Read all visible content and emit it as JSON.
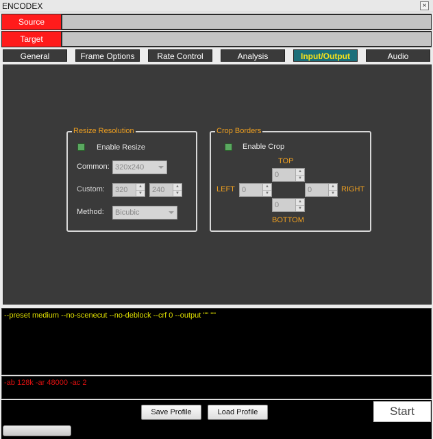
{
  "window": {
    "title": "ENCODEX",
    "close_glyph": "×"
  },
  "source": {
    "label": "Source",
    "path": ""
  },
  "target": {
    "label": "Target",
    "path": ""
  },
  "tabs": [
    {
      "label": "General"
    },
    {
      "label": "Frame Options"
    },
    {
      "label": "Rate Control"
    },
    {
      "label": "Analysis"
    },
    {
      "label": "Input/Output",
      "active": true
    },
    {
      "label": "Audio"
    }
  ],
  "resize": {
    "legend": "Resize Resolution",
    "enable_label": "Enable Resize",
    "common_label": "Common:",
    "common_value": "320x240",
    "custom_label": "Custom:",
    "custom_width": "320",
    "custom_height": "240",
    "method_label": "Method:",
    "method_value": "Bicubic"
  },
  "crop": {
    "legend": "Crop Borders",
    "enable_label": "Enable Crop",
    "top_label": "TOP",
    "bottom_label": "BOTTOM",
    "left_label": "LEFT",
    "right_label": "RIGHT",
    "top_value": "0",
    "bottom_value": "0",
    "left_value": "0",
    "right_value": "0"
  },
  "command_line": "--preset medium --no-scenecut --no-deblock --crf 0 --output \"\" \"\"",
  "audio_line": "-ab 128k -ar 48000 -ac 2",
  "buttons": {
    "save_profile": "Save Profile",
    "load_profile": "Load Profile",
    "start": "Start"
  },
  "colors": {
    "source_target": "#ff1b1b",
    "tab_active": "#1c6f7a",
    "tab_active_text": "#f4e11c",
    "accent": "#f0a020",
    "command_text": "#e0e000",
    "audio_text": "#e01010"
  }
}
